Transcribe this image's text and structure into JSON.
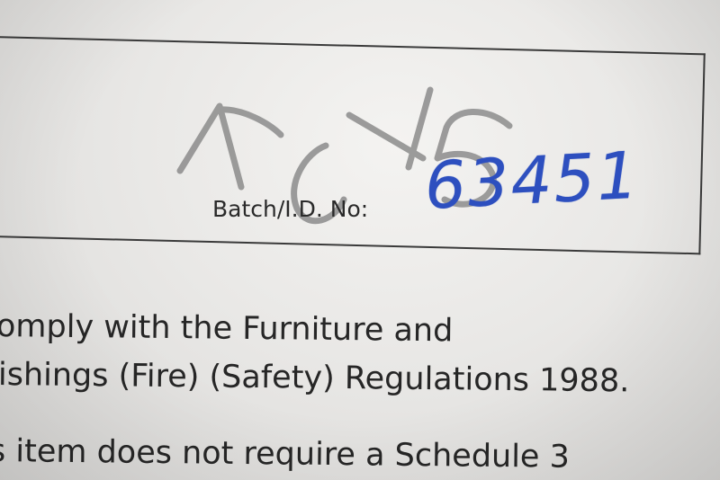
{
  "batch": {
    "label": "Batch/I.D. No:",
    "number": "63451"
  },
  "body_lines": [
    "omply with the Furniture and",
    "ishings (Fire) (Safety) Regulations 1988.",
    "s item does not require a Schedule 3"
  ],
  "colors": {
    "ink_blue": "#2d4fbf",
    "pencil_grey": "#8c8c8c",
    "print_black": "#262626"
  }
}
